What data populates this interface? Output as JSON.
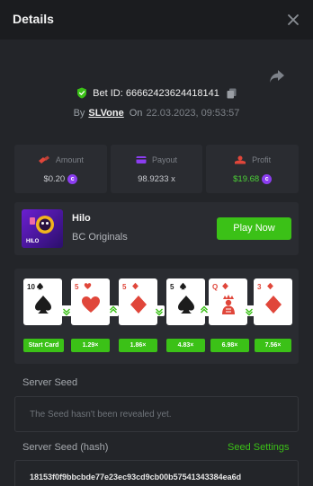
{
  "header": {
    "title": "Details"
  },
  "bet": {
    "id_label": "Bet ID: 66662423624418141",
    "by_label": "By",
    "user": "SLVone",
    "on_label": "On",
    "date": "22.03.2023, 09:53:57"
  },
  "stats": [
    {
      "label": "Amount",
      "value": "$0.20"
    },
    {
      "label": "Payout",
      "value": "98.9233 x"
    },
    {
      "label": "Profit",
      "value": "$19.68"
    }
  ],
  "game": {
    "thumb_label": "HILO",
    "name": "Hilo",
    "provider": "BC Originals",
    "play_label": "Play Now"
  },
  "cards": [
    {
      "rank": "10",
      "suit": "spade"
    },
    {
      "rank": "5",
      "suit": "heart"
    },
    {
      "rank": "5",
      "suit": "diamond"
    },
    {
      "rank": "5",
      "suit": "spade"
    },
    {
      "rank": "Q",
      "suit": "diamond"
    },
    {
      "rank": "3",
      "suit": "diamond"
    }
  ],
  "multipliers": [
    "Start Card",
    "1.29×",
    "1.86×",
    "4.83×",
    "6.98×",
    "7.56×"
  ],
  "server_seed": {
    "label": "Server Seed",
    "placeholder": "The Seed hasn't been revealed yet."
  },
  "server_seed_hash": {
    "label": "Server Seed (hash)",
    "settings_label": "Seed Settings",
    "value": "18153f0f9bbcbde77e23ec93cd9cb00b57541343384ea6d"
  },
  "colors": {
    "accent": "#3bc117",
    "coin": "#8b3df0",
    "red_suit": "#e0463a"
  }
}
